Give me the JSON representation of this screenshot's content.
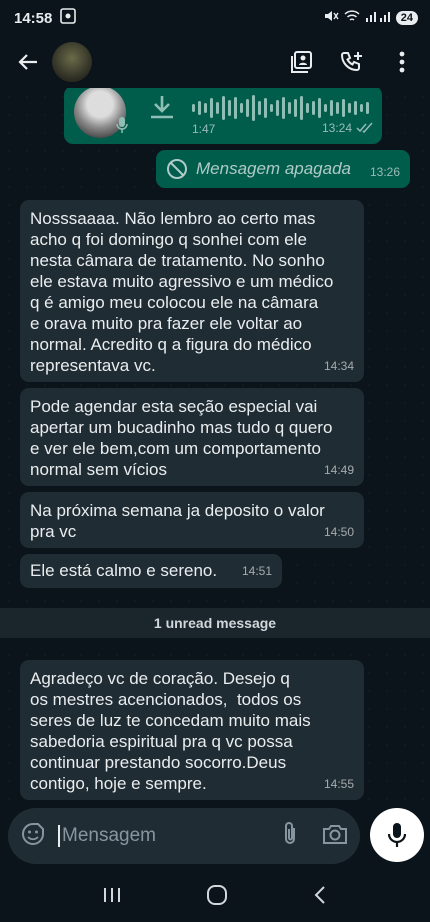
{
  "status_bar": {
    "time": "14:58",
    "battery": "24"
  },
  "header": {
    "back_icon": "arrow-left-icon",
    "actions": [
      "contact-card-icon",
      "add-call-icon",
      "more-vert-icon"
    ]
  },
  "voice_message": {
    "duration": "1:47",
    "time": "13:24"
  },
  "deleted_message": {
    "text": "Mensagem apagada",
    "time": "13:26"
  },
  "messages": [
    {
      "text": "Nosssaaaa. Não lembro ao certo mas\nacho q foi domingo q sonhei com ele\nnesta câmara de tratamento. No sonho\nele estava muito agressivo e um médico\nq é amigo meu colocou ele na câmara\ne orava muito pra fazer ele voltar ao\nnormal. Acredito q a figura do médico\nrepresentava vc.",
      "time": "14:34"
    },
    {
      "text": "Pode agendar esta seção especial vai\napertar um bucadinho mas tudo q quero\ne ver ele bem,com um comportamento\nnormal sem vícios",
      "time": "14:49"
    },
    {
      "text": "Na próxima semana ja deposito o valor\npra vc",
      "time": "14:50"
    },
    {
      "text": "Ele está calmo e sereno.",
      "time": "14:51"
    },
    {
      "text": "Agradeço vc de coração. Desejo q\nos mestres acencionados,  todos os\nseres de luz te concedam muito mais\nsabedoria espiritual pra q vc possa\ncontinuar prestando socorro.Deus\ncontigo, hoje e sempre.",
      "time": "14:55"
    }
  ],
  "unread_divider": "1 unread message",
  "composer": {
    "placeholder": "Mensagem"
  },
  "colors": {
    "incoming": "#202c33",
    "outgoing": "#005c4b",
    "background": "#0b141a"
  }
}
